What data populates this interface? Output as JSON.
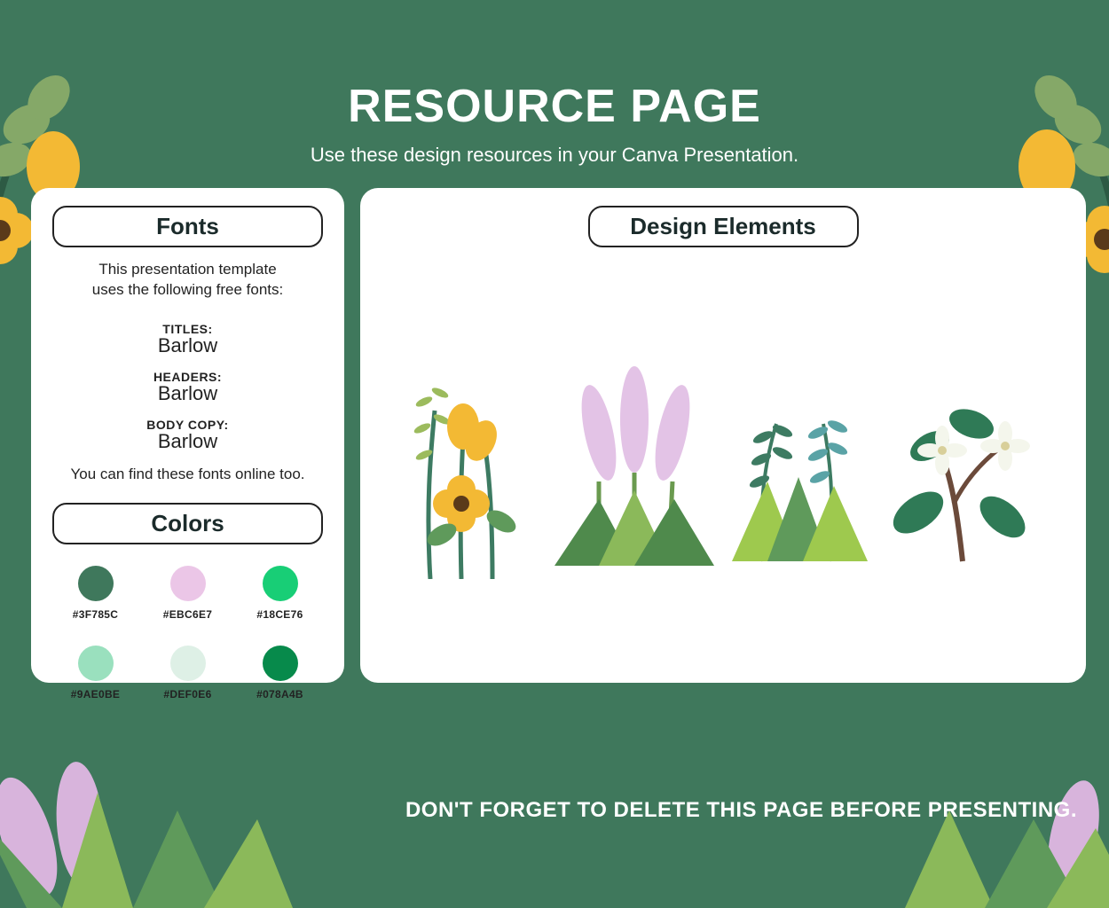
{
  "header": {
    "title": "RESOURCE PAGE",
    "subtitle": "Use these design resources in your Canva Presentation."
  },
  "fonts_card": {
    "pill_label": "Fonts",
    "intro_line1": "This presentation template",
    "intro_line2": "uses the following free fonts:",
    "sections": [
      {
        "label": "TITLES:",
        "name": "Barlow"
      },
      {
        "label": "HEADERS:",
        "name": "Barlow"
      },
      {
        "label": "BODY COPY:",
        "name": "Barlow"
      }
    ],
    "note": "You can find these fonts online too."
  },
  "colors_card": {
    "pill_label": "Colors",
    "swatches": [
      {
        "hex": "#3F785C"
      },
      {
        "hex": "#EBC6E7"
      },
      {
        "hex": "#18CE76"
      },
      {
        "hex": "#9AE0BE"
      },
      {
        "hex": "#DEF0E6"
      },
      {
        "hex": "#078A4B"
      }
    ]
  },
  "elements_card": {
    "pill_label": "Design Elements"
  },
  "footer": {
    "note": "DON'T FORGET TO DELETE THIS PAGE BEFORE PRESENTING."
  }
}
